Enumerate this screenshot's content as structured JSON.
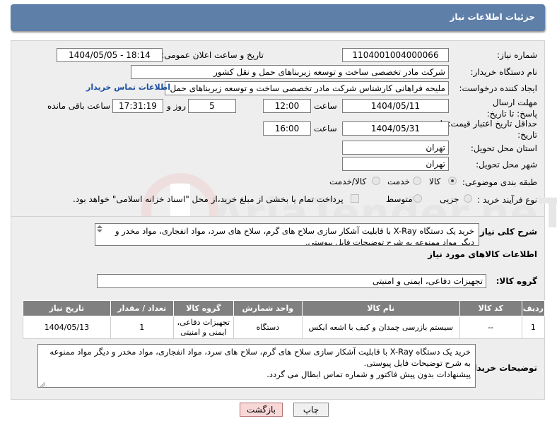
{
  "header": {
    "title": "جزئیات اطلاعات نیاز"
  },
  "watermark": {
    "text": "AriaTender.neT"
  },
  "fields": {
    "need_number_label": "شماره نیاز:",
    "need_number": "1104001004000066",
    "announce_label": "تاریخ و ساعت اعلان عمومی:",
    "announce_value": "1404/05/05 - 18:14",
    "buyer_org_label": "نام دستگاه خریدار:",
    "buyer_org": "شرکت مادر تخصصی ساخت و توسعه زیربناهای حمل و نقل کشور",
    "creator_label": "ایجاد کننده درخواست:",
    "creator": "ملیحه فراهانی کارشناس شرکت مادر تخصصی ساخت و توسعه زیربناهای حمل",
    "contact_link": "اطلاعات تماس خریدار",
    "deadline_label": "مهلت ارسال پاسخ: تا تاریخ:",
    "deadline_date": "1404/05/11",
    "time_label": "ساعت",
    "deadline_time": "12:00",
    "days_value": "5",
    "days_label": "روز و",
    "remaining_time": "17:31:19",
    "remaining_label": "ساعت باقی مانده",
    "validity_label": "حداقل تاریخ اعتبار قیمت: تا تاریخ:",
    "validity_date": "1404/05/31",
    "validity_time": "16:00",
    "province_label": "استان محل تحویل:",
    "province": "تهران",
    "city_label": "شهر محل تحویل:",
    "city": "تهران",
    "category_label": "طبقه بندی موضوعی:",
    "category_options": [
      "کالا",
      "خدمت",
      "کالا/خدمت"
    ],
    "process_label": "نوع فرآیند خرید :",
    "process_options": [
      "جزیی",
      "متوسط"
    ],
    "payment_note": "پرداخت تمام یا بخشی از مبلغ خرید،از محل \"اسناد خزانه اسلامی\" خواهد بود."
  },
  "description": {
    "label": "شرح کلی نیاز:",
    "text": "خرید یک دستگاه X-Ray  با قابلیت آشکار سازی سلاح های گرم، سلاح های سرد، مواد انفجاری، مواد مخدر و دیگر مواد ممنوعه  به شرح توضیحات فایل پیوستی."
  },
  "goods": {
    "section_title": "اطلاعات کالاهای مورد نیاز",
    "group_label": "گروه کالا:",
    "group_value": "تجهیزات دفاعی، ایمنی و امنیتی",
    "columns": [
      "ردیف",
      "کد کالا",
      "نام کالا",
      "واحد شمارش",
      "گروه کالا",
      "تعداد / مقدار",
      "تاریخ نیاز"
    ],
    "rows": [
      [
        "1",
        "--",
        "سیستم بازرسی چمدان و کیف با اشعه ایکس",
        "دستگاه",
        "تجهیزات دفاعی، ایمنی و امنیتی",
        "1",
        "1404/05/13"
      ]
    ]
  },
  "buyer_notes": {
    "label": "توضیحات خریدار:",
    "line1": "خرید یک دستگاه X-Ray  با قابلیت آشکار سازی سلاح های گرم، سلاح های سرد، مواد انفجاری، مواد مخدر و دیگر مواد ممنوعه  به شرح توضیحات فایل پیوستی.",
    "line2": "پیشنهادات بدون پیش فاکتور و شماره تماس ابطال می گردد."
  },
  "buttons": {
    "print": "چاپ",
    "back": "بازگشت"
  }
}
